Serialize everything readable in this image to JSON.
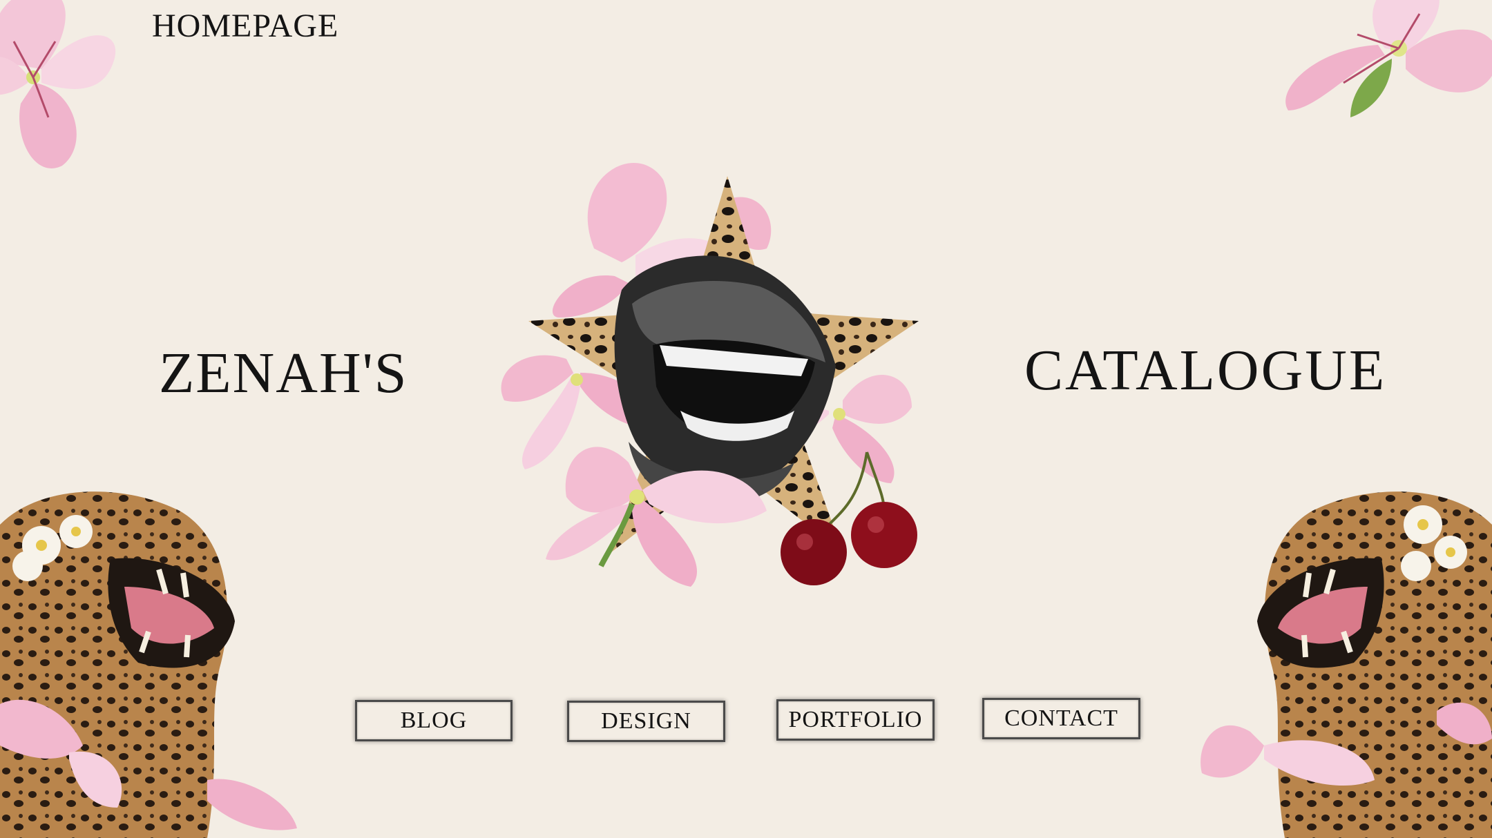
{
  "page": {
    "heading": "HOMEPAGE"
  },
  "hero": {
    "title_left": "ZENAH'S",
    "title_right": "CATALOGUE"
  },
  "nav": {
    "blog": "BLOG",
    "design": "DESIGN",
    "portfolio": "PORTFOLIO",
    "contact": "CONTACT"
  },
  "colors": {
    "background": "#f3ede4",
    "text": "#141414",
    "lily_pink": "#f2b7cf",
    "cherry_red": "#8e0f1c",
    "leopard_tan": "#c9a06a"
  },
  "decorations": [
    "lily-flower-top-left",
    "lily-flower-top-right",
    "leopard-star-collage",
    "leopard-left",
    "leopard-right"
  ]
}
